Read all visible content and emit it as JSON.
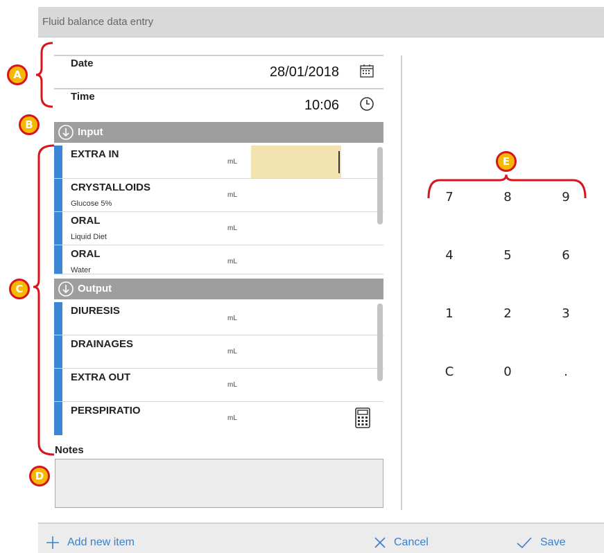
{
  "window": {
    "title": "Fluid balance data entry"
  },
  "date_field": {
    "label": "Date",
    "value": "28/01/2018",
    "icon": "calendar-icon"
  },
  "time_field": {
    "label": "Time",
    "value": "10:06",
    "icon": "clock-icon"
  },
  "input_section": {
    "title": "Input",
    "icon": "arrow-down-circle-icon",
    "items": [
      {
        "name": "EXTRA IN",
        "sub": "",
        "unit": "mL",
        "value": ""
      },
      {
        "name": "CRYSTALLOIDS",
        "sub": "Glucose 5%",
        "unit": "mL",
        "value": ""
      },
      {
        "name": "ORAL",
        "sub": "Liquid Diet",
        "unit": "mL",
        "value": ""
      },
      {
        "name": "ORAL",
        "sub": "Water",
        "unit": "mL",
        "value": ""
      }
    ]
  },
  "output_section": {
    "title": "Output",
    "icon": "arrow-down-circle-icon",
    "items": [
      {
        "name": "DIURESIS",
        "unit": "mL",
        "value": ""
      },
      {
        "name": "DRAINAGES",
        "unit": "mL",
        "value": ""
      },
      {
        "name": "EXTRA OUT",
        "unit": "mL",
        "value": ""
      },
      {
        "name": "PERSPIRATIO",
        "unit": "mL",
        "value": "",
        "icon": "calculator-icon"
      }
    ]
  },
  "notes": {
    "label": "Notes",
    "value": ""
  },
  "keypad": {
    "keys": [
      "7",
      "8",
      "9",
      "4",
      "5",
      "6",
      "1",
      "2",
      "3",
      "C",
      "0",
      "."
    ]
  },
  "footer": {
    "add_label": "Add new item",
    "cancel_label": "Cancel",
    "save_label": "Save"
  },
  "callouts": [
    "A",
    "B",
    "C",
    "D",
    "E"
  ],
  "colors": {
    "accent": "#3c86d6",
    "section_header": "#9e9e9e",
    "active_input": "#f2e3b0",
    "callout_fill": "#f6b800",
    "callout_border": "#d6161c"
  }
}
